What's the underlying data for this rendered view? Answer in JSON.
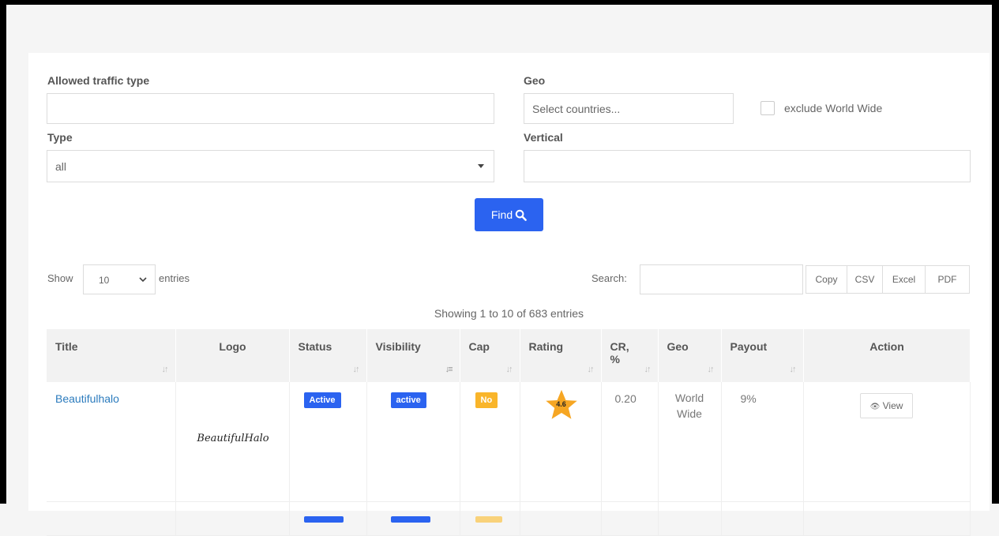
{
  "filters": {
    "traffic_label": "Allowed traffic type",
    "traffic_value": "",
    "geo_label": "Geo",
    "geo_placeholder": "Select countries...",
    "exclude_label": "exclude World Wide",
    "type_label": "Type",
    "type_value": "all",
    "vertical_label": "Vertical",
    "vertical_value": "",
    "find_label": "Find"
  },
  "controls": {
    "show_label": "Show",
    "entries_value": "10",
    "entries_label": "entries",
    "search_label": "Search:",
    "search_value": "",
    "export_buttons": [
      "Copy",
      "CSV",
      "Excel",
      "PDF"
    ],
    "info": "Showing 1 to 10 of 683 entries"
  },
  "table": {
    "headers": [
      "Title",
      "Logo",
      "Status",
      "Visibility",
      "Cap",
      "Rating",
      "CR, %",
      "Geo",
      "Payout",
      "Action"
    ],
    "rows": [
      {
        "title": "Beautifulhalo",
        "logo_text": "BeautifulHalo",
        "status": "Active",
        "visibility": "active",
        "cap": "No",
        "rating": "4.6",
        "cr": "0.20",
        "geo": "World Wide",
        "payout": "9%",
        "action": "View"
      }
    ]
  },
  "colors": {
    "primary": "#2b63f0",
    "badge_status": "#2b63f0",
    "badge_cap": "#f9b52a",
    "star": "#f6a623",
    "link": "#2b7bbd"
  },
  "icons": {
    "find": "search-icon",
    "view": "eye-icon",
    "rating": "star-icon",
    "sort": "sort-icon"
  }
}
